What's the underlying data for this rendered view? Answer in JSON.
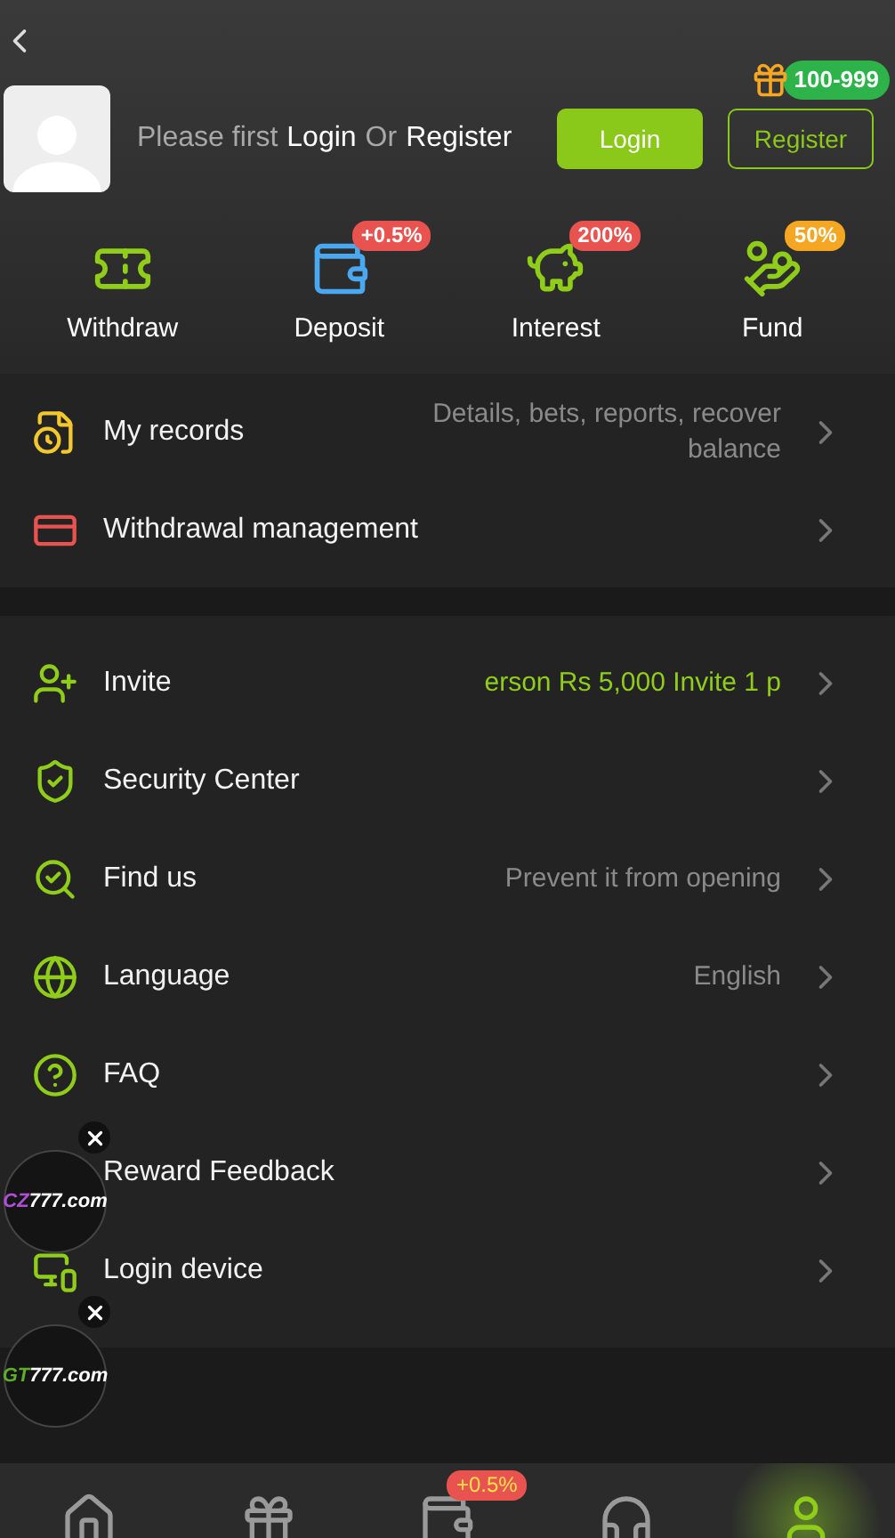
{
  "header": {
    "prompt_parts": [
      {
        "text": "Please first",
        "kind": "plain"
      },
      {
        "text": "Login",
        "kind": "link"
      },
      {
        "text": "Or",
        "kind": "plain"
      },
      {
        "text": "Register",
        "kind": "link"
      }
    ],
    "login_button": "Login",
    "register_button": "Register",
    "gift_badge": "100-999"
  },
  "quick_actions": [
    {
      "label": "Withdraw",
      "kind": "withdraw"
    },
    {
      "label": "Deposit",
      "kind": "deposit",
      "badge": "+0.5%",
      "color": "#e8534f"
    },
    {
      "label": "Interest",
      "kind": "interest",
      "badge": "200%",
      "color": "#e8534f"
    },
    {
      "label": "Fund",
      "kind": "fund",
      "badge": "50%",
      "color": "#f5a623"
    }
  ],
  "records_menu": [
    {
      "label": "My records",
      "value": "Details, bets, reports, recover balance",
      "kind": "records",
      "highlight": false
    },
    {
      "label": "Withdrawal management",
      "kind": "withdrawal"
    }
  ],
  "main_menu": [
    {
      "label": "Invite",
      "value": "erson Rs 5,000  Invite 1 p",
      "kind": "invite",
      "highlight": true
    },
    {
      "label": "Security Center",
      "kind": "security"
    },
    {
      "label": "Find us",
      "value": "Prevent it from opening",
      "kind": "find",
      "highlight": false
    },
    {
      "label": "Language",
      "value": "English",
      "kind": "language",
      "highlight": false
    },
    {
      "label": "FAQ",
      "kind": "faq"
    },
    {
      "label": "Reward Feedback",
      "kind": "feedback"
    },
    {
      "label": "Login device",
      "kind": "device"
    }
  ],
  "floating_ads": [
    {
      "logo_a": "CZ",
      "logo_b": "777.com",
      "color": "#b04fd6"
    },
    {
      "logo_a": "GT",
      "logo_b": "777.com",
      "color": "#5fae2a"
    }
  ],
  "bottom_nav": [
    {
      "kind": "home",
      "selected": false
    },
    {
      "kind": "gift",
      "selected": false
    },
    {
      "kind": "wallet",
      "selected": false,
      "badge": "+0.5%"
    },
    {
      "kind": "support",
      "selected": false
    },
    {
      "kind": "profile",
      "selected": true
    }
  ]
}
